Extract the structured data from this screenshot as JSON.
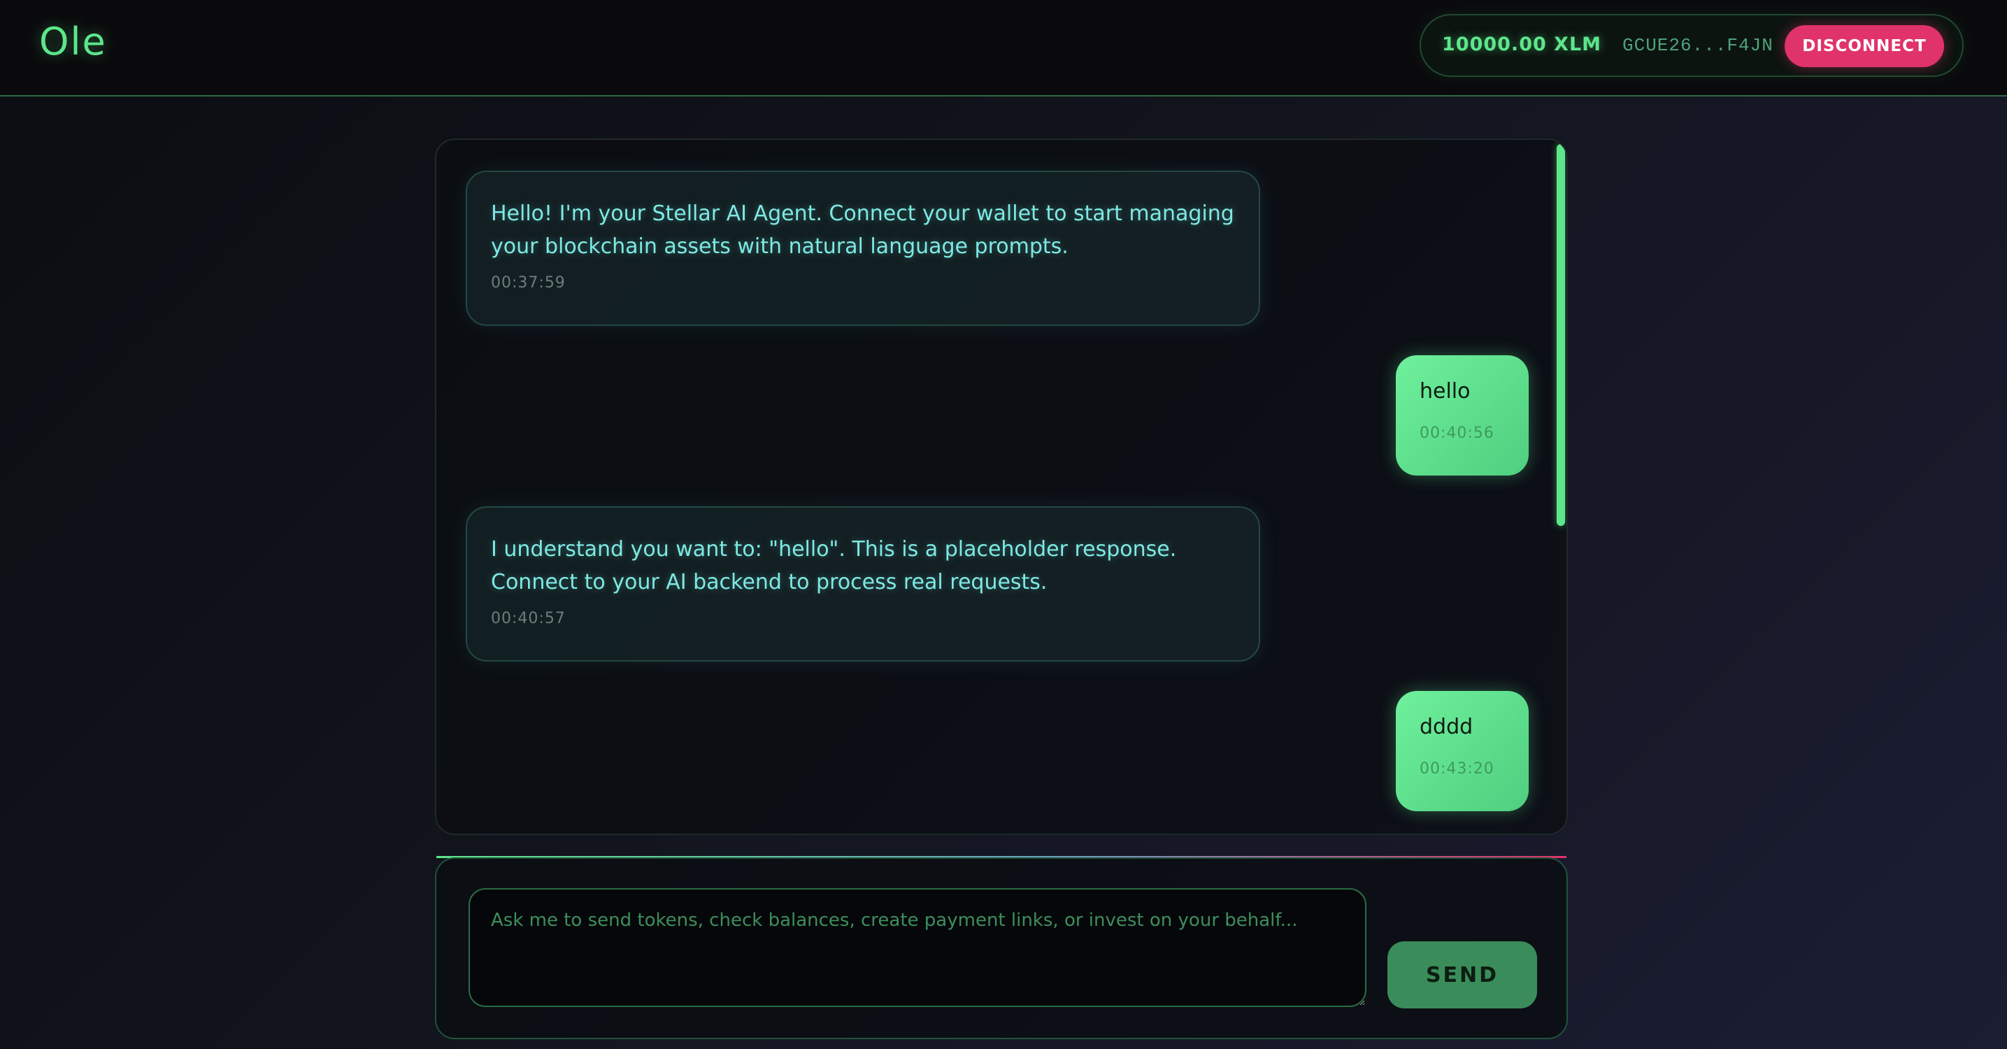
{
  "header": {
    "logo": "Ole",
    "wallet": {
      "balance": "10000.00 XLM",
      "address": "GCUE26...F4JN",
      "disconnect_label": "DISCONNECT"
    }
  },
  "chat": {
    "messages": [
      {
        "role": "agent",
        "text": "Hello! I'm your Stellar AI Agent. Connect your wallet to start managing your blockchain assets with natural language prompts.",
        "time": "00:37:59"
      },
      {
        "role": "user",
        "text": "hello",
        "time": "00:40:56"
      },
      {
        "role": "agent",
        "text": "I understand you want to: \"hello\". This is a placeholder response. Connect to your AI backend to process real requests.",
        "time": "00:40:57"
      },
      {
        "role": "user",
        "text": "dddd",
        "time": "00:43:20"
      }
    ]
  },
  "composer": {
    "placeholder": "Ask me to send tokens, check balances, create payment links, or invest on your behalf...",
    "value": "",
    "send_label": "SEND"
  },
  "colors": {
    "accent": "#5de68b",
    "agent_text": "#7de9e3",
    "disconnect": "#e0336a",
    "background": "#0c0d12"
  }
}
